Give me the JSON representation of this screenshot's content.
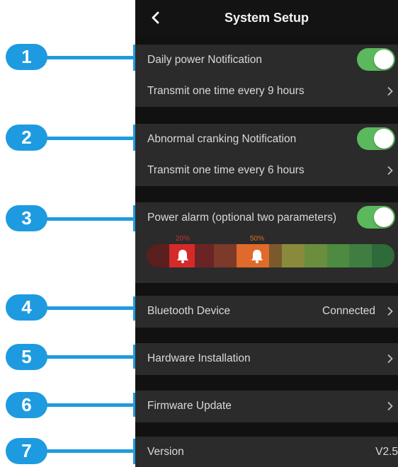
{
  "header": {
    "title": "System Setup",
    "back_icon": "back-chevron-icon"
  },
  "daily_notification": {
    "label": "Daily power Notification",
    "enabled": true,
    "frequency": "Transmit one time every 9 hours"
  },
  "cranking_notification": {
    "label": "Abnormal cranking Notification",
    "enabled": true,
    "frequency": "Transmit one time every 6 hours"
  },
  "power_alarm": {
    "label": "Power alarm (optional two parameters)",
    "enabled": true,
    "low_marker": "20%",
    "high_marker": "50%",
    "marker_icon": "bell-icon",
    "gauge_colors": [
      "#5a1f1f",
      "#d42a2a",
      "#6b2424",
      "#7b3a2a",
      "#e06a2b",
      "#7a5a2c",
      "#8a8a3c",
      "#6a8e3c",
      "#4e8a40",
      "#3f7e40",
      "#2f6a3a"
    ]
  },
  "bluetooth": {
    "label": "Bluetooth Device",
    "status": "Connected"
  },
  "hardware": {
    "label": "Hardware Installation"
  },
  "firmware": {
    "label": "Firmware Update"
  },
  "version": {
    "label": "Version",
    "value": "V2.5"
  },
  "callouts": [
    "1",
    "2",
    "3",
    "4",
    "5",
    "6",
    "7"
  ],
  "colors": {
    "accent": "#1e9be0",
    "toggle_on": "#5cb85c",
    "panel": "#2b2b2b",
    "background": "#111111"
  }
}
